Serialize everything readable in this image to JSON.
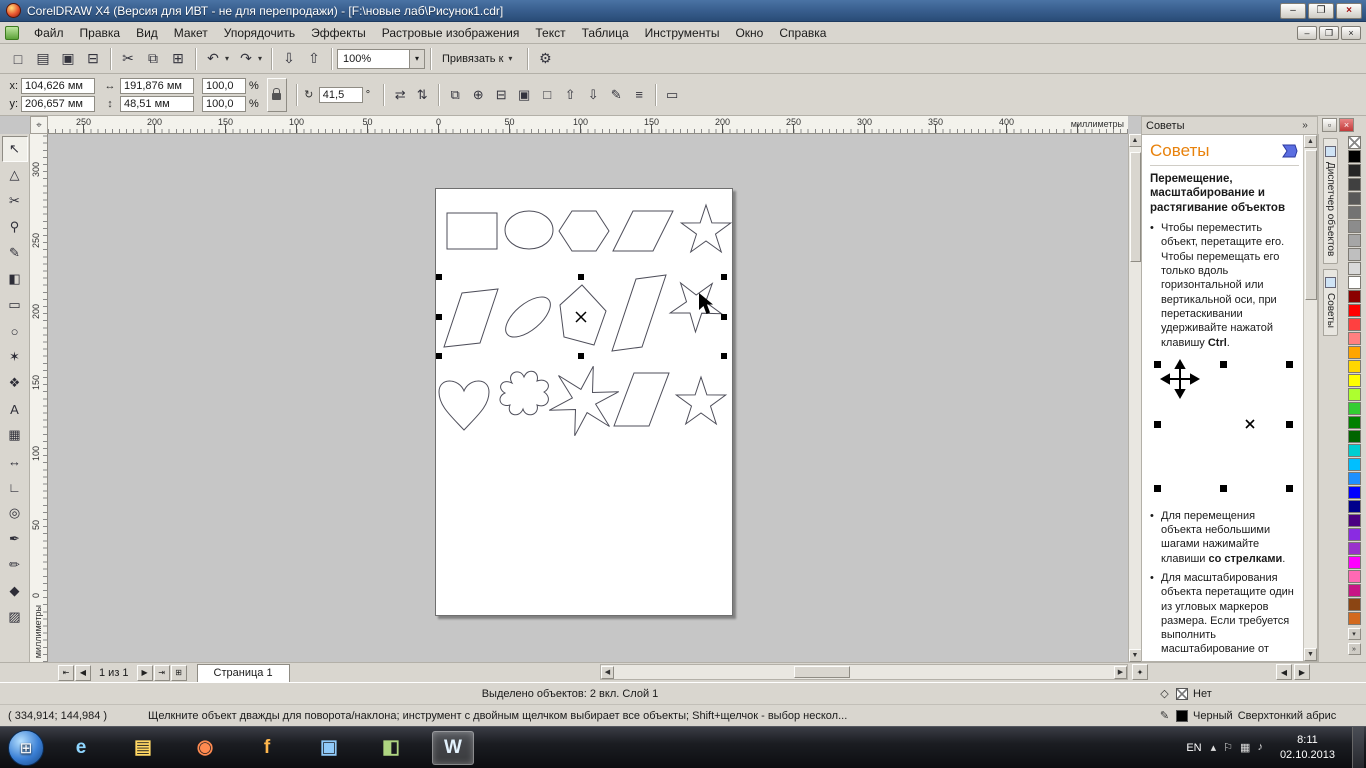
{
  "titlebar": {
    "title": "CorelDRAW X4 (Версия для ИВТ - не для перепродажи) - [F:\\новые лаб\\Рисунок1.cdr]",
    "minimize": "–",
    "restore": "❐",
    "close": "×"
  },
  "menubar": {
    "items": [
      {
        "name": "menu-file",
        "label": "Файл"
      },
      {
        "name": "menu-edit",
        "label": "Правка"
      },
      {
        "name": "menu-view",
        "label": "Вид"
      },
      {
        "name": "menu-layout",
        "label": "Макет"
      },
      {
        "name": "menu-arrange",
        "label": "Упорядочить"
      },
      {
        "name": "menu-effects",
        "label": "Эффекты"
      },
      {
        "name": "menu-bitmaps",
        "label": "Растровые изображения"
      },
      {
        "name": "menu-text",
        "label": "Текст"
      },
      {
        "name": "menu-table",
        "label": "Таблица"
      },
      {
        "name": "menu-tools",
        "label": "Инструменты"
      },
      {
        "name": "menu-window",
        "label": "Окно"
      },
      {
        "name": "menu-help",
        "label": "Справка"
      }
    ],
    "minimize": "–",
    "restore": "❐",
    "close": "×"
  },
  "toolbar": {
    "group1": [
      {
        "name": "new-button",
        "glyph": "□"
      },
      {
        "name": "open-button",
        "glyph": "▤"
      },
      {
        "name": "save-button",
        "glyph": "▣"
      },
      {
        "name": "print-button",
        "glyph": "⊟"
      }
    ],
    "group2": [
      {
        "name": "cut-button",
        "glyph": "✂"
      },
      {
        "name": "copy-button",
        "glyph": "⧉"
      },
      {
        "name": "paste-button",
        "glyph": "⊞"
      }
    ],
    "group3": [
      {
        "name": "undo-button",
        "glyph": "↶",
        "caret": "▾"
      },
      {
        "name": "redo-button",
        "glyph": "↷",
        "caret": "▾"
      }
    ],
    "group4": [
      {
        "name": "import-button",
        "glyph": "⇩"
      },
      {
        "name": "export-button",
        "glyph": "⇧"
      }
    ],
    "zoom_value": "100%",
    "snap_label": "Привязать к",
    "caret": "▾",
    "options_glyph": "⚙"
  },
  "property_bar": {
    "x_label": "x:",
    "x_value": "104,626 мм",
    "y_label": "y:",
    "y_value": "206,657 мм",
    "width_icon": "↔",
    "height_icon": "↕",
    "width_value": "191,876 мм",
    "height_value": "48,51 мм",
    "scale_h": "100,0",
    "scale_v": "100,0",
    "percent": "%",
    "rotate_glyph": "↻",
    "angle_value": "41,5",
    "degree": "°",
    "mirror_h": "⇄",
    "mirror_v": "⇅",
    "buttons": [
      {
        "name": "combine-button",
        "glyph": "⧉"
      },
      {
        "name": "weld-button",
        "glyph": "⊕"
      },
      {
        "name": "trim-button",
        "glyph": "⊟"
      },
      {
        "name": "group-button",
        "glyph": "▣"
      },
      {
        "name": "ungroup-button",
        "glyph": "□"
      },
      {
        "name": "to-front-button",
        "glyph": "⇧"
      },
      {
        "name": "to-back-button",
        "glyph": "⇩"
      },
      {
        "name": "convert-curves-button",
        "glyph": "✎"
      },
      {
        "name": "wrap-text-button",
        "glyph": "≡"
      }
    ],
    "more_glyph": "▭"
  },
  "rulers": {
    "origin_glyph": "⌖",
    "horizontal": [
      "250",
      "200",
      "150",
      "100",
      "50",
      "0",
      "50",
      "100",
      "150",
      "200",
      "250",
      "300",
      "350",
      "400"
    ],
    "vertical": [
      "300",
      "250",
      "200",
      "150",
      "100",
      "50",
      "0"
    ],
    "unit": "миллиметры"
  },
  "toolbox": {
    "tools": [
      {
        "name": "pick-tool",
        "glyph": "↖",
        "active": true
      },
      {
        "name": "shape-tool",
        "glyph": "△"
      },
      {
        "name": "crop-tool",
        "glyph": "✂"
      },
      {
        "name": "zoom-tool",
        "glyph": "⚲"
      },
      {
        "name": "freehand-tool",
        "glyph": "✎"
      },
      {
        "name": "smart-fill-tool",
        "glyph": "◧"
      },
      {
        "name": "rectangle-tool",
        "glyph": "▭"
      },
      {
        "name": "ellipse-tool",
        "glyph": "○"
      },
      {
        "name": "polygon-tool",
        "glyph": "✶"
      },
      {
        "name": "basic-shapes-tool",
        "glyph": "❖"
      },
      {
        "name": "text-tool",
        "glyph": "А"
      },
      {
        "name": "table-tool",
        "glyph": "▦"
      },
      {
        "name": "dimension-tool",
        "glyph": "↔"
      },
      {
        "name": "connector-tool",
        "glyph": "∟"
      },
      {
        "name": "blend-tool",
        "glyph": "◎"
      },
      {
        "name": "eyedropper-tool",
        "glyph": "✒"
      },
      {
        "name": "outline-tool",
        "glyph": "✏"
      },
      {
        "name": "fill-tool",
        "glyph": "◆"
      },
      {
        "name": "interactive-fill-tool",
        "glyph": "▨"
      }
    ]
  },
  "docker": {
    "header_title": "Советы",
    "expand_glyph": "»",
    "float_glyph": "▫",
    "close_glyph": "×",
    "heading": "Советы",
    "subheading": "Перемещение, масштабирование и растягивание объектов",
    "bullet1_text": "Чтобы переместить объект, перетащите его. Чтобы перемещать его только вдоль горизонтальной или вертикальной оси, при перетаскивании удерживайте нажатой клавишу ",
    "bullet1_bold": "Ctrl",
    "bullet1_tail": ".",
    "bullet2_text": "Для перемещения объекта небольшими шагами нажимайте клавиши ",
    "bullet2_bold": "со стрелками",
    "bullet2_tail": ".",
    "bullet3_text": "Для масштабирования объекта перетащите один из угловых маркеров размера. Если требуется выполнить масштабирование от",
    "tabs": [
      {
        "name": "docker-tab-object-manager",
        "label": "Диспетчер объектов"
      },
      {
        "name": "docker-tab-hints",
        "label": "Советы"
      }
    ]
  },
  "palette": {
    "down_glyph": "▾",
    "more_glyph": "»",
    "colors": [
      "#000000",
      "#262626",
      "#404040",
      "#595959",
      "#737373",
      "#8c8c8c",
      "#a6a6a6",
      "#bfbfbf",
      "#d9d9d9",
      "#ffffff",
      "#8b0000",
      "#ff0000",
      "#ff4040",
      "#ff8080",
      "#ffa500",
      "#ffd700",
      "#ffff00",
      "#adff2f",
      "#32cd32",
      "#008000",
      "#006400",
      "#00ced1",
      "#00bfff",
      "#1e90ff",
      "#0000ff",
      "#00008b",
      "#4b0082",
      "#8a2be2",
      "#9932cc",
      "#ff00ff",
      "#ff69b4",
      "#c71585",
      "#8b4513",
      "#d2691e"
    ]
  },
  "page_nav": {
    "first": "⇤",
    "prev": "◀",
    "label": "1 из 1",
    "next": "▶",
    "last": "⇥",
    "add": "⊞",
    "tab": "Страница 1",
    "scroll_left": "◀",
    "scroll_right": "▶",
    "lock_glyph": "✦"
  },
  "status": {
    "selected": "Выделено объектов: 2 вкл. Слой 1",
    "coords": "( 334,914; 144,984 )",
    "hint": "Щелкните объект дважды для поворота/наклона; инструмент с двойным щелчком выбирает все объекты; Shift+щелчок - выбор нескол...",
    "fill_icon": "◇",
    "fill_label": "Нет",
    "outline_icon": "✎",
    "outline_color": "Черный",
    "outline_style": "Сверхтонкий абрис"
  },
  "taskbar": {
    "start_glyph": "⊞",
    "apps": [
      {
        "name": "taskbar-internet-explorer",
        "glyph": "e",
        "color": "#8fd6ff"
      },
      {
        "name": "taskbar-explorer",
        "glyph": "▤",
        "color": "#ffd764"
      },
      {
        "name": "taskbar-media-player",
        "glyph": "◉",
        "color": "#ff8a50"
      },
      {
        "name": "taskbar-firefox",
        "glyph": "f",
        "color": "#ffb74d"
      },
      {
        "name": "taskbar-save-app",
        "glyph": "▣",
        "color": "#90caf9"
      },
      {
        "name": "taskbar-green-app",
        "glyph": "◧",
        "color": "#aed581"
      },
      {
        "name": "taskbar-word",
        "glyph": "W",
        "color": "#e3f2fd",
        "active": true
      }
    ],
    "tray_icons": [
      {
        "name": "hidden-icons-button",
        "glyph": "▴"
      },
      {
        "name": "flag-icon",
        "glyph": "⚐"
      },
      {
        "name": "network-icon",
        "glyph": "▦"
      },
      {
        "name": "volume-icon",
        "glyph": "♪"
      }
    ],
    "lang": "EN",
    "time": "8:11",
    "date": "02.10.2013"
  }
}
